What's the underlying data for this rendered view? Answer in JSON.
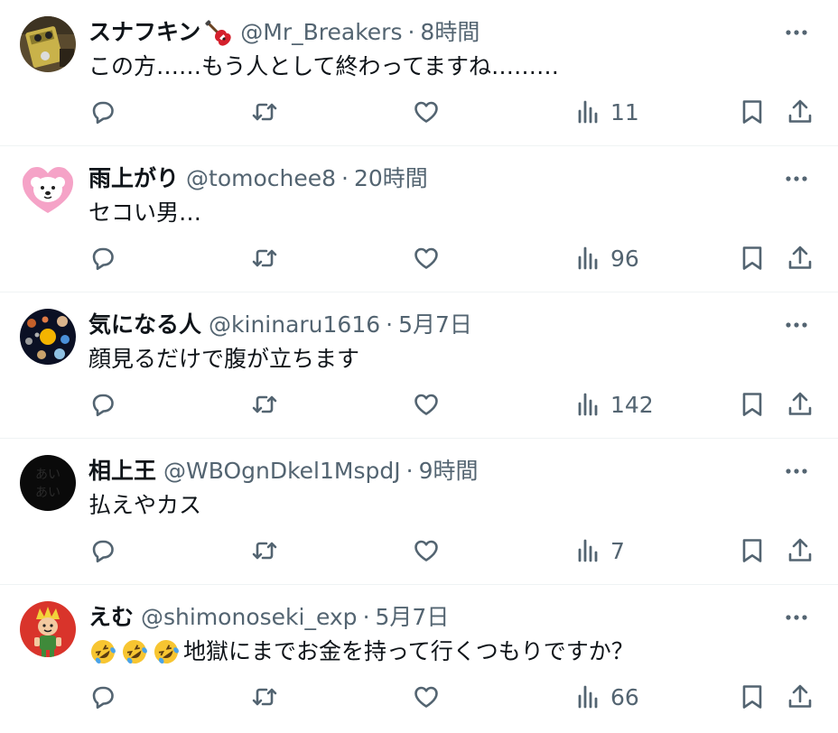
{
  "colors": {
    "text_primary": "#0f1419",
    "text_secondary": "#536471",
    "divider": "#eff3f4",
    "background": "#ffffff"
  },
  "icons": {
    "reply": "speech-bubble-icon",
    "retweet": "retweet-arrows-icon",
    "like": "heart-outline-icon",
    "views": "bar-chart-icon",
    "bookmark": "bookmark-icon",
    "share": "share-upload-icon",
    "more": "three-dots-icon"
  },
  "tweets": [
    {
      "display_name": "スナフキン",
      "name_emoji": "guitar-emoji",
      "handle": "@Mr_Breakers",
      "separator": "·",
      "timestamp": "8時間",
      "text": "この方……もう人として終わってますね………",
      "views": "11",
      "avatar": "guitar-effects-pedal-photo"
    },
    {
      "display_name": "雨上がり",
      "handle": "@tomochee8",
      "separator": "·",
      "timestamp": "20時間",
      "text": "セコい男…",
      "views": "96",
      "avatar": "white-dog-on-pink-heart"
    },
    {
      "display_name": "気になる人",
      "handle": "@kininaru1616",
      "separator": "·",
      "timestamp": "5月7日",
      "text": "顔見るだけで腹が立ちます",
      "views": "142",
      "avatar": "solar-system-planets"
    },
    {
      "display_name": "相上王",
      "handle": "@WBOgnDkel1MspdJ",
      "separator": "·",
      "timestamp": "9時間",
      "text": "払えやカス",
      "views": "7",
      "avatar": "black-circle-with-text",
      "avatar_text_top": "あい",
      "avatar_text_bottom": "あい"
    },
    {
      "display_name": "えむ",
      "handle": "@shimonoseki_exp",
      "separator": "·",
      "timestamp": "5月7日",
      "text": "地獄にまでお金を持って行くつもりですか？",
      "text_prefix_emoji": [
        "rolling-on-floor-laughing-emoji",
        "rolling-on-floor-laughing-emoji",
        "rolling-on-floor-laughing-emoji"
      ],
      "views": "66",
      "avatar": "cartoon-character-red-background"
    }
  ]
}
